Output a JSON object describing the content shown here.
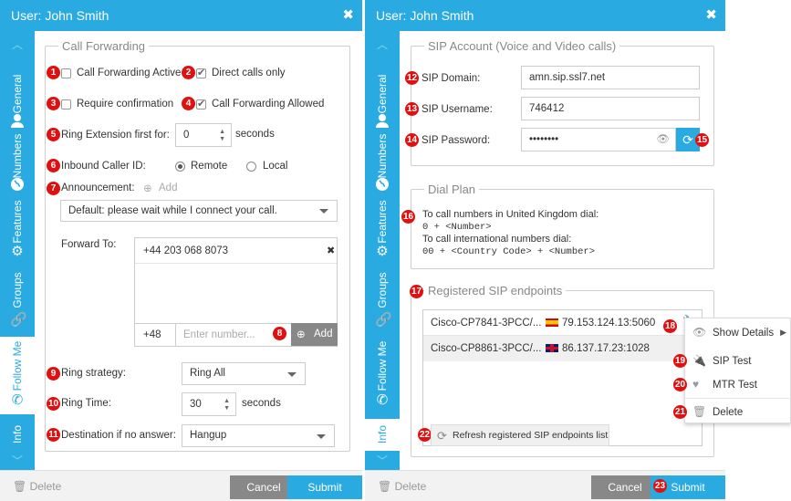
{
  "left_panel": {
    "title": "User: John Smith",
    "close_icon": "✖",
    "side_tabs": [
      "General",
      "Numbers",
      "Features",
      "Groups",
      "Follow Me",
      "Info"
    ],
    "active_tab": "Follow Me",
    "call_forwarding": {
      "legend": "Call Forwarding",
      "call_forwarding_active": {
        "label": "Call Forwarding Active",
        "checked": false
      },
      "direct_calls_only": {
        "label": "Direct calls only",
        "checked": true
      },
      "require_confirmation": {
        "label": "Require confirmation",
        "checked": false
      },
      "call_forwarding_allowed": {
        "label": "Call Forwarding Allowed",
        "checked": true
      },
      "ring_extension_label": "Ring Extension first for:",
      "ring_extension_value": "0",
      "ring_extension_unit": "seconds",
      "inbound_caller_id_label": "Inbound Caller ID:",
      "caller_id_remote": "Remote",
      "caller_id_local": "Local",
      "caller_id_selected": "Remote",
      "announcement_label": "Announcement:",
      "announcement_add": "Add",
      "announcement_value": "Default: please wait while I connect your call.",
      "forward_to_label": "Forward To:",
      "forward_numbers": [
        "+44 203 068 8073"
      ],
      "country_code": "+48",
      "number_placeholder": "Enter number...",
      "add_button": "Add",
      "ring_strategy_label": "Ring strategy:",
      "ring_strategy_value": "Ring All",
      "ring_time_label": "Ring Time:",
      "ring_time_value": "30",
      "ring_time_unit": "seconds",
      "destination_label": "Destination if no answer:",
      "destination_value": "Hangup"
    },
    "footer": {
      "delete": "Delete",
      "cancel": "Cancel",
      "submit": "Submit"
    }
  },
  "right_panel": {
    "title": "User: John Smith",
    "close_icon": "✖",
    "side_tabs": [
      "General",
      "Numbers",
      "Features",
      "Groups",
      "Follow Me",
      "Info"
    ],
    "active_tab": "Info",
    "sip_account": {
      "legend": "SIP Account (Voice and Video calls)",
      "domain_label": "SIP Domain:",
      "domain_value": "amn.sip.ssl7.net",
      "username_label": "SIP Username:",
      "username_value": "746412",
      "password_label": "SIP Password:",
      "password_value": "••••••••"
    },
    "dial_plan": {
      "legend": "Dial Plan",
      "lines": [
        "To call numbers in United Kingdom dial:",
        "0 + <Number>",
        "To call international numbers dial:",
        "00 + <Country Code> + <Number>"
      ]
    },
    "registered_endpoints": {
      "legend": "Registered SIP endpoints",
      "rows": [
        {
          "device": "Cisco-CP7841-3PCC/...",
          "flag": "ES",
          "address": "79.153.124.13:5060"
        },
        {
          "device": "Cisco-CP8861-3PCC/...",
          "flag": "GB",
          "address": "86.137.17.23:1028"
        }
      ],
      "refresh_button": "Refresh registered SIP endpoints list"
    },
    "context_menu": [
      "Show Details",
      "SIP Test",
      "MTR Test",
      "Delete"
    ],
    "footer": {
      "delete": "Delete",
      "cancel": "Cancel",
      "submit": "Submit"
    }
  },
  "badges": [
    "1",
    "2",
    "3",
    "4",
    "5",
    "6",
    "7",
    "8",
    "9",
    "10",
    "11",
    "12",
    "13",
    "14",
    "15",
    "16",
    "17",
    "18",
    "19",
    "20",
    "21",
    "22",
    "23"
  ],
  "colors": {
    "accent": "#29abe2",
    "badge": "#e01010",
    "cancel": "#888888"
  }
}
